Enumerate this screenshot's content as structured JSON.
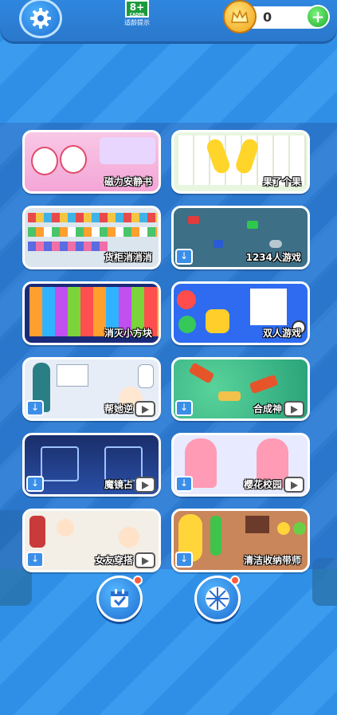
{
  "header": {
    "settings_icon": "gear-icon",
    "age_rating": "8+",
    "age_rating_org": "CADPA",
    "age_rating_caption": "适龄提示",
    "coin_icon": "crown-coin-icon",
    "coin_count": "0",
    "add_coin_label": "+"
  },
  "games": [
    {
      "label": "磁力安静书",
      "download": false,
      "video": false
    },
    {
      "label": "果了个果",
      "download": false,
      "video": false
    },
    {
      "label": "货柜消消消",
      "download": false,
      "video": false
    },
    {
      "label": "1234人游戏",
      "download": true,
      "video": false
    },
    {
      "label": "消灭小方块",
      "download": false,
      "video": false
    },
    {
      "label": "双人游戏",
      "download": false,
      "video": false
    },
    {
      "label": "帮她逆",
      "download": true,
      "video": true
    },
    {
      "label": "合成神",
      "download": true,
      "video": true
    },
    {
      "label": "魔镜占",
      "download": true,
      "video": true
    },
    {
      "label": "樱花校园",
      "download": true,
      "video": true
    },
    {
      "label": "女友穿搭",
      "download": true,
      "video": true
    },
    {
      "label": "清洁收纳带师",
      "download": true,
      "video": false
    }
  ],
  "bottom": {
    "calendar_icon": "calendar-check-icon",
    "wheel_icon": "prize-wheel-icon"
  }
}
